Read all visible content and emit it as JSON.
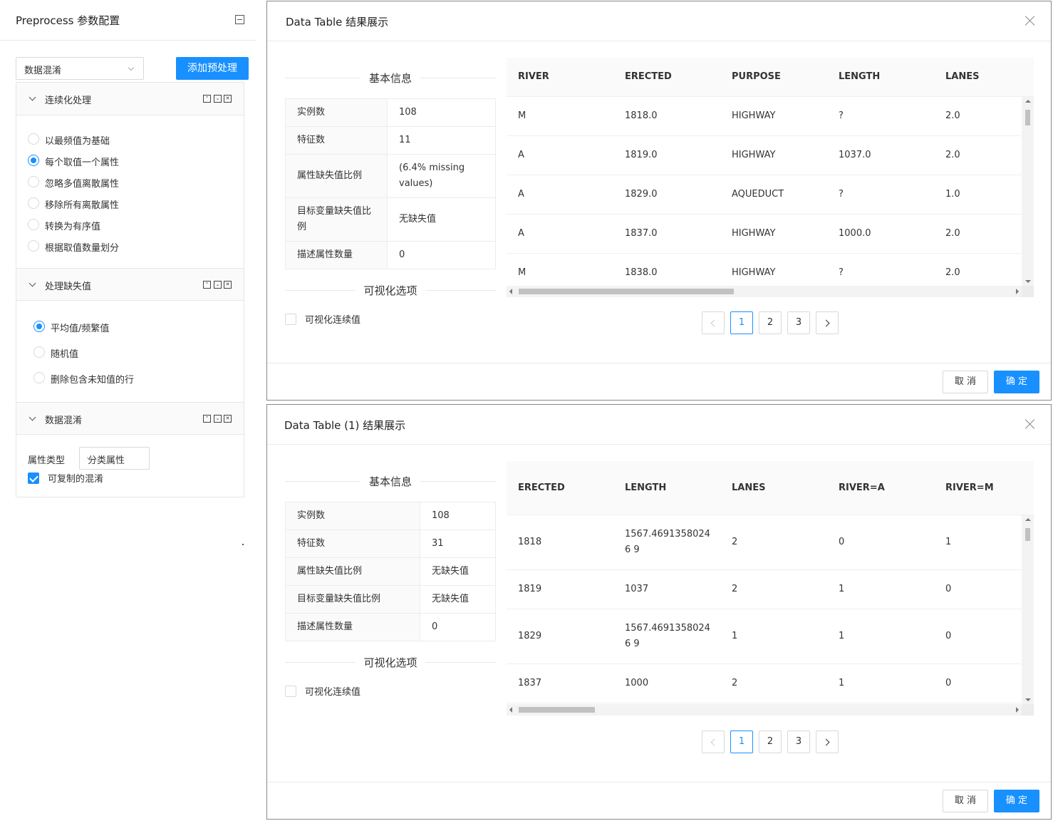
{
  "left_panel": {
    "title": "Preprocess 参数配置",
    "method_select": "数据混淆",
    "add_button": "添加预处理",
    "sections": {
      "continuize": {
        "title": "连续化处理",
        "controls": [
          "⌃",
          "⌄",
          "✕"
        ],
        "options": [
          "以最频值为基础",
          "每个取值一个属性",
          "忽略多值离散属性",
          "移除所有离散属性",
          "转换为有序值",
          "根据取值数量划分"
        ],
        "selected": 1
      },
      "impute": {
        "title": "处理缺失值",
        "controls": [
          "⌃",
          "⌄",
          "✕"
        ],
        "options": [
          "平均值/频繁值",
          "随机值",
          "删除包含未知值的行"
        ],
        "selected": 0
      },
      "obfuscate": {
        "title": "数据混淆",
        "controls": [
          "⌃",
          "⌄",
          "✕"
        ],
        "attr_type_label": "属性类型",
        "attr_type_value": "分类属性",
        "replicable_label": "可复制的混淆",
        "replicable_checked": true
      }
    }
  },
  "modal1": {
    "title": "Data Table 结果展示",
    "basic_info_title": "基本信息",
    "info_rows": [
      {
        "key": "实例数",
        "value": "108"
      },
      {
        "key": "特征数",
        "value": "11"
      },
      {
        "key": "属性缺失值比例",
        "value": "(6.4% missing values)"
      },
      {
        "key": "目标变量缺失值比例",
        "value": "无缺失值"
      },
      {
        "key": "描述属性数量",
        "value": "0"
      }
    ],
    "vis_title": "可视化选项",
    "vis_checkbox": "可视化连续值",
    "columns": [
      "RIVER",
      "ERECTED",
      "PURPOSE",
      "LENGTH",
      "LANES"
    ],
    "rows": [
      [
        "M",
        "1818.0",
        "HIGHWAY",
        "?",
        "2.0"
      ],
      [
        "A",
        "1819.0",
        "HIGHWAY",
        "1037.0",
        "2.0"
      ],
      [
        "A",
        "1829.0",
        "AQUEDUCT",
        "?",
        "1.0"
      ],
      [
        "A",
        "1837.0",
        "HIGHWAY",
        "1000.0",
        "2.0"
      ],
      [
        "M",
        "1838.0",
        "HIGHWAY",
        "?",
        "2.0"
      ]
    ],
    "pages": [
      "1",
      "2",
      "3"
    ],
    "current_page": "1",
    "cancel": "取 消",
    "ok": "确 定"
  },
  "modal2": {
    "title": "Data Table (1) 结果展示",
    "basic_info_title": "基本信息",
    "info_rows": [
      {
        "key": "实例数",
        "value": "108"
      },
      {
        "key": "特征数",
        "value": "31"
      },
      {
        "key": "属性缺失值比例",
        "value": "无缺失值"
      },
      {
        "key": "目标变量缺失值比例",
        "value": "无缺失值"
      },
      {
        "key": "描述属性数量",
        "value": "0"
      }
    ],
    "vis_title": "可视化选项",
    "vis_checkbox": "可视化连续值",
    "columns": [
      "ERECTED",
      "LENGTH",
      "LANES",
      "RIVER=A",
      "RIVER=M"
    ],
    "rows": [
      [
        "1818",
        "1567.46913580246 9",
        "2",
        "0",
        "1"
      ],
      [
        "1819",
        "1037",
        "2",
        "1",
        "0"
      ],
      [
        "1829",
        "1567.46913580246 9",
        "1",
        "1",
        "0"
      ],
      [
        "1837",
        "1000",
        "2",
        "1",
        "0"
      ]
    ],
    "pages": [
      "1",
      "2",
      "3"
    ],
    "current_page": "1",
    "cancel": "取 消",
    "ok": "确 定"
  }
}
